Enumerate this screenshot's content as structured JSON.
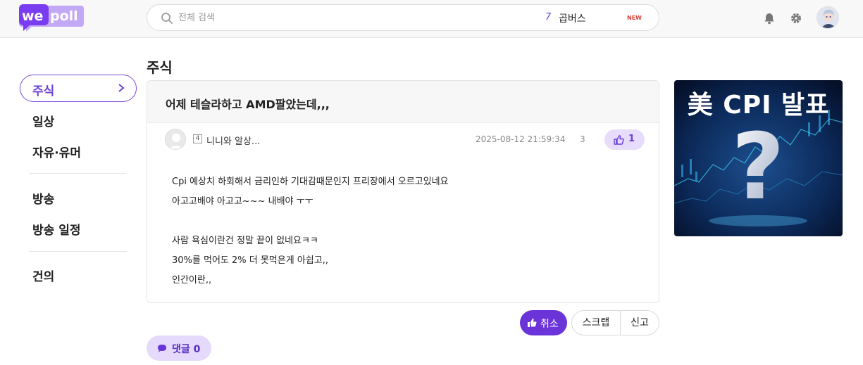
{
  "header": {
    "logo_text": "we poll",
    "search_placeholder": "전체 검색",
    "trending": {
      "rank": "7",
      "text": "곱버스",
      "badge": "NEW"
    }
  },
  "sidebar": {
    "active": "주식",
    "items": [
      "일상",
      "자유·유머",
      "방송",
      "방송 일정",
      "건의"
    ]
  },
  "main": {
    "category_title": "주식",
    "post": {
      "title": "어제 테슬라하고 AMD팔았는데,,,",
      "author_level": "4",
      "author": "니니와 알상...",
      "date": "2025-08-12 21:59:34",
      "views": "3",
      "likes": "1",
      "body": [
        "Cpi 예상치 하회해서 금리인하 기대감때문인지 프리장에서 오르고있네요",
        "아고고배야 아고고~~~ 내배야 ㅜㅜ",
        "",
        "사람 욕심이란건 정말 끝이 없네요ㅋㅋ",
        "30%를 먹어도 2% 더 못먹은게 아쉽고,,",
        "인간이란,,"
      ]
    },
    "actions": {
      "cancel": "취소",
      "scrap": "스크랩",
      "report": "신고"
    },
    "comment": {
      "label": "댓글",
      "count": "0"
    }
  },
  "thumbnail": {
    "text": "美 CPI 발표",
    "symbol": "?"
  },
  "colors": {
    "accent": "#6a34d8",
    "accent_light": "#e7dcfb",
    "badge_red": "#e0403a"
  }
}
